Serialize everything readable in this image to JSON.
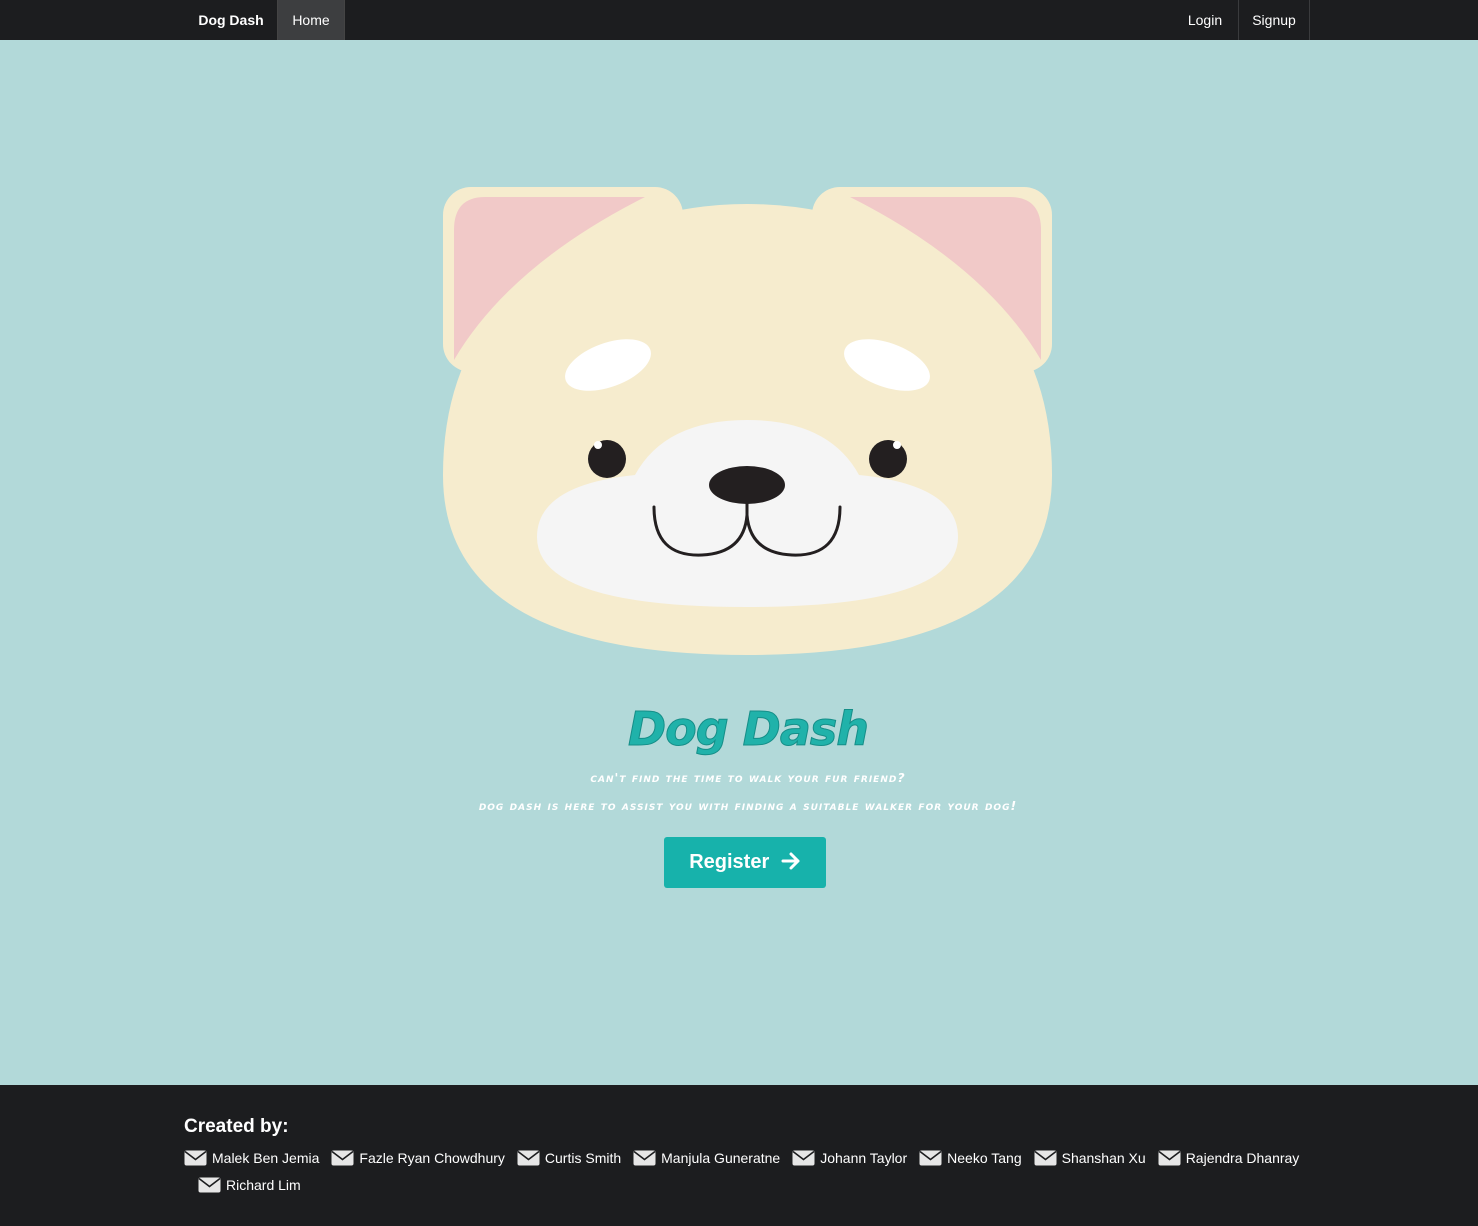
{
  "nav": {
    "brand": "Dog Dash",
    "home": "Home",
    "login": "Login",
    "signup": "Signup"
  },
  "hero": {
    "title": "Dog Dash",
    "tagline_1": "Can't find the time to walk your fur friend?",
    "tagline_2": "Dog Dash is here to assist you with finding a suitable walker for your dog!",
    "register_label": "Register",
    "register_icon": "arrow-right-icon"
  },
  "footer": {
    "created_by": "Created by:",
    "creator_icon": "envelope-icon",
    "creators": [
      "Malek Ben Jemia",
      "Fazle Ryan Chowdhury",
      "Curtis Smith",
      "Manjula Guneratne",
      "Johann Taylor",
      "Neeko Tang",
      "Shanshan Xu",
      "Rajendra Dhanray",
      "Richard Lim"
    ]
  },
  "colors": {
    "background": "#b2d9d9",
    "navbar": "#1c1d1f",
    "accent": "#17b2ab",
    "dog_face": "#f6ecce",
    "dog_ear_inner": "#f1c9c8"
  }
}
